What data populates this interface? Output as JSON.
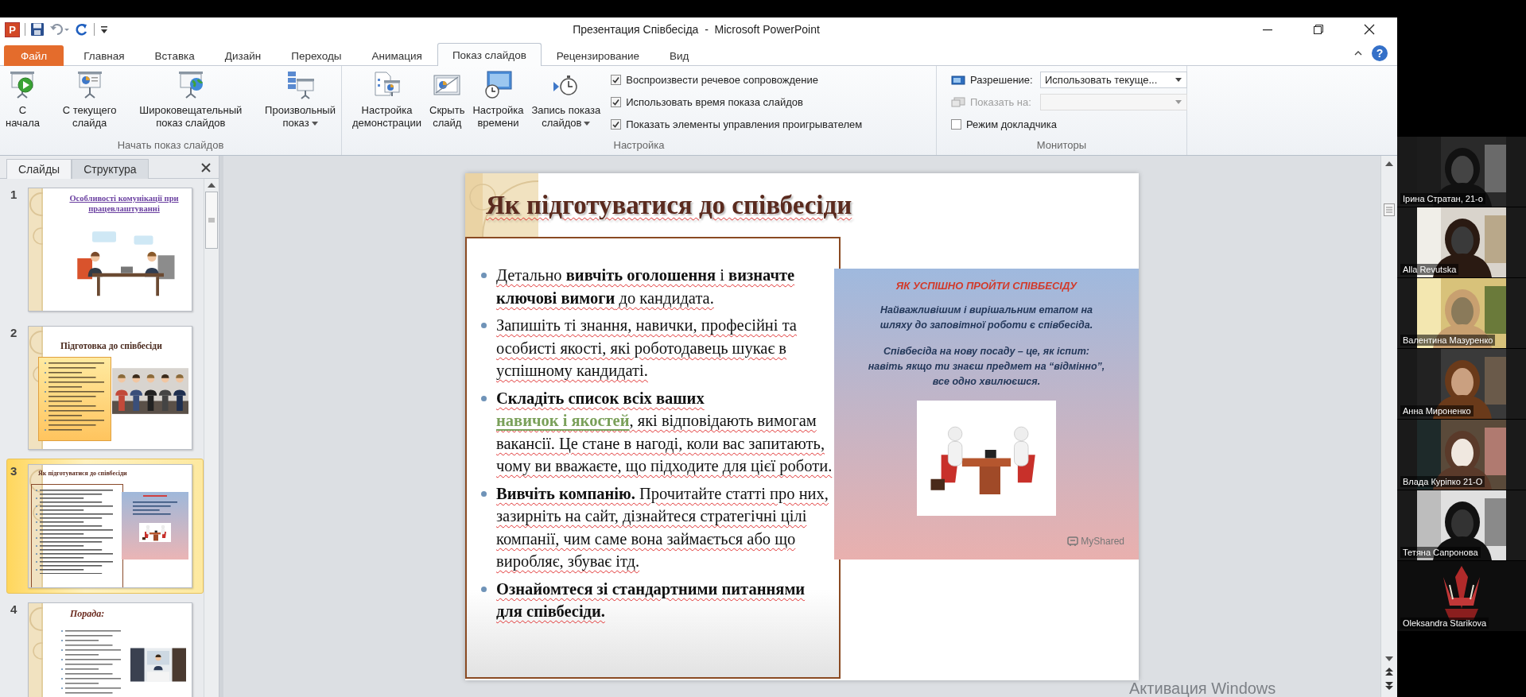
{
  "window": {
    "title": "Презентация Співбесіда  -  Microsoft PowerPoint",
    "app_icon": "P"
  },
  "ribbon_tabs": [
    {
      "label": "Файл",
      "kind": "file",
      "selected": false
    },
    {
      "label": "Главная",
      "kind": "tab",
      "selected": false
    },
    {
      "label": "Вставка",
      "kind": "tab",
      "selected": false
    },
    {
      "label": "Дизайн",
      "kind": "tab",
      "selected": false
    },
    {
      "label": "Переходы",
      "kind": "tab",
      "selected": false
    },
    {
      "label": "Анимация",
      "kind": "tab",
      "selected": false
    },
    {
      "label": "Показ слайдов",
      "kind": "tab",
      "selected": true
    },
    {
      "label": "Рецензирование",
      "kind": "tab",
      "selected": false
    },
    {
      "label": "Вид",
      "kind": "tab",
      "selected": false
    }
  ],
  "help_button": "?",
  "ribbon_groups": [
    {
      "label": "Начать показ слайдов",
      "items": [
        {
          "kind": "large",
          "label": "С\nначала",
          "has_menu": false
        },
        {
          "kind": "large",
          "label": "С текущего\nслайда",
          "has_menu": false
        },
        {
          "kind": "large",
          "label": "Широковещательный\nпоказ слайдов",
          "has_menu": false
        },
        {
          "kind": "large",
          "label": "Произвольный\nпоказ",
          "has_menu": true
        }
      ]
    },
    {
      "label": "Настройка",
      "items": [
        {
          "kind": "large",
          "label": "Настройка\nдемонстрации",
          "has_menu": false
        },
        {
          "kind": "large",
          "label": "Скрыть\nслайд",
          "has_menu": false
        },
        {
          "kind": "large",
          "label": "Настройка\nвремени",
          "has_menu": false
        },
        {
          "kind": "large",
          "label": "Запись показа\nслайдов",
          "has_menu": true
        },
        {
          "kind": "checkbox",
          "label": "Воспроизвести речевое сопровождение",
          "checked": true
        },
        {
          "kind": "checkbox",
          "label": "Использовать время показа слайдов",
          "checked": true
        },
        {
          "kind": "checkbox",
          "label": "Показать элементы управления проигрывателем",
          "checked": true
        }
      ]
    },
    {
      "label": "Мониторы",
      "items": [
        {
          "kind": "dropdown",
          "label": "Разрешение:",
          "value": "Использовать текуще...",
          "disabled": false
        },
        {
          "kind": "dropdown",
          "label": "Показать на:",
          "disabled": true
        },
        {
          "kind": "checkbox",
          "label": "Режим докладчика",
          "checked": false
        }
      ]
    }
  ],
  "slides_pane": {
    "tabs": [
      {
        "label": "Слайды",
        "selected": true
      },
      {
        "label": "Структура",
        "selected": false
      }
    ],
    "thumbnails": [
      {
        "number": "1",
        "title": "Особливості комунікації при працевлаштуванні",
        "kind": "cover",
        "selected": false
      },
      {
        "number": "2",
        "title": "Підготовка до співбесіди",
        "kind": "boxed",
        "selected": false
      },
      {
        "number": "3",
        "title": "Як підготуватися до співбесіди",
        "kind": "framed",
        "selected": true
      },
      {
        "number": "4",
        "title": "Порада:",
        "kind": "list",
        "selected": false
      }
    ]
  },
  "slide": {
    "title": "Як підготуватися до співбесіди",
    "spell_check_marks": true,
    "bullets": [
      {
        "parts": [
          {
            "text": "Детально ",
            "kind": "plain"
          },
          {
            "text": "вивчіть оголошення",
            "kind": "bold"
          },
          {
            "text": " і ",
            "kind": "plain"
          },
          {
            "text": "визначте ключові вимоги",
            "kind": "bold"
          },
          {
            "text": " до кандидата.",
            "kind": "plain"
          }
        ]
      },
      {
        "parts": [
          {
            "text": "Запишіть ті знання, навички, професійні та особисті якості, які роботодавець шукає в успішному кандидаті.",
            "kind": "plain"
          }
        ]
      },
      {
        "parts": [
          {
            "text": "Складіть список всіх ваших ",
            "kind": "bold"
          },
          {
            "text": "навичок і якостей",
            "kind": "link"
          },
          {
            "text": ", які відповідають вимогам вакансії. Це стане в нагоді, коли вас запитають, чому ви вважаєте, що підходите для цієї роботи.",
            "kind": "plain"
          }
        ]
      },
      {
        "parts": [
          {
            "text": "Вивчіть компанію.",
            "kind": "bold"
          },
          {
            "text": " Прочитайте статті про них, зазирніть на сайт, дізнайтеся стратегічні цілі компанії, чим саме вона займається або що виробляє, збуває ітд.",
            "kind": "plain"
          }
        ]
      },
      {
        "parts": [
          {
            "text": "Ознайомтеся зі стандартними питаннями для співбесіди.",
            "kind": "bold"
          }
        ]
      }
    ],
    "infographic": {
      "heading": "ЯК УСПІШНО ПРОЙТИ СПІВБЕСІДУ",
      "paragraphs": [
        "Найважливішим і вирішальним етапом на шляху до заповітної роботи є співбесіда.",
        "Співбесіда на нову посаду – це, як іспит: навіть якщо ти знаєш предмет на “відмінно”, все одно хвилюєшся."
      ],
      "logo": "MyShared"
    }
  },
  "participants": [
    {
      "name": "Ірина Стратан, 21-о"
    },
    {
      "name": "Alla Revutska"
    },
    {
      "name": "Валентина Мазуренко"
    },
    {
      "name": "Анна Мироненко"
    },
    {
      "name": "Влада Куріпко 21-О"
    },
    {
      "name": "Тетяна Сапронова"
    },
    {
      "name": "Oleksandra Starikova"
    }
  ],
  "os_notice": "Активация Windows"
}
